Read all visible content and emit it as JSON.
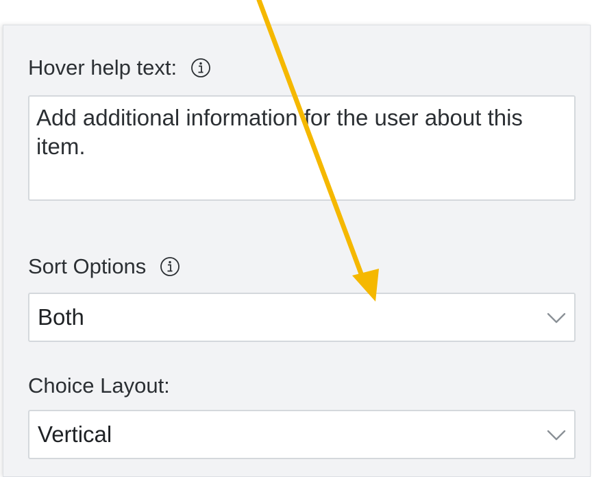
{
  "hover_help": {
    "label": "Hover help text:",
    "value": "Add additional information for the user about this item."
  },
  "sort_options": {
    "label": "Sort Options",
    "selected": "Both"
  },
  "choice_layout": {
    "label": "Choice Layout:",
    "selected": "Vertical"
  },
  "icons": {
    "info": "info-icon",
    "dropdown": "chevron-down-icon",
    "annotation": "arrow-annotation"
  },
  "colors": {
    "panel_bg": "#f2f3f5",
    "annotation_arrow": "#f5b800",
    "icon": "#2b2f33"
  }
}
